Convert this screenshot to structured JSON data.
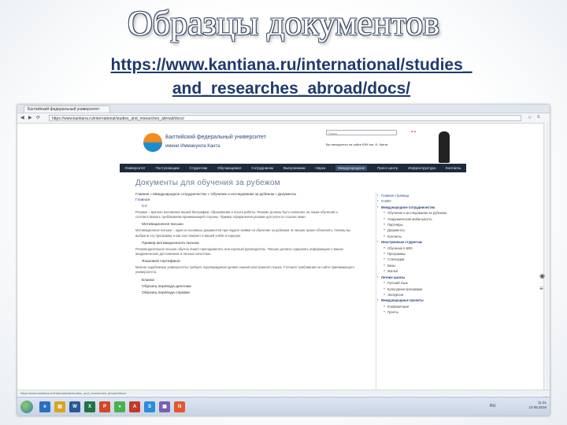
{
  "slide": {
    "title": "Образцы документов",
    "url_line1": "https://www.kantiana.ru/international/studies_",
    "url_line2": "and_researches_abroad/docs/"
  },
  "browser": {
    "tab_label": "Балтийский федеральный университет",
    "address": "https://www.kantiana.ru/international/studies_and_researches_abroad/docs/",
    "status_text": "https://www.kantiana.ru/international/studies_and_researches_abroad/docs/"
  },
  "site": {
    "name": "Балтийский федеральный университет",
    "sub": "имени Иммануила Канта",
    "search_placeholder": "Поиск",
    "flags": "▪ ▪",
    "note": "Вы находитесь на сайте БФУ им. И. Канта"
  },
  "menu": [
    {
      "label": "Университет",
      "active": false
    },
    {
      "label": "Поступающим",
      "active": false
    },
    {
      "label": "Студентам",
      "active": false
    },
    {
      "label": "Обучающимся",
      "active": false
    },
    {
      "label": "Сотрудникам",
      "active": false
    },
    {
      "label": "Выпускникам",
      "active": false
    },
    {
      "label": "Наука",
      "active": false
    },
    {
      "label": "Международное",
      "active": true
    },
    {
      "label": "Пресс-центр",
      "active": false
    },
    {
      "label": "Инфраструктура",
      "active": false
    },
    {
      "label": "Контакты",
      "active": false
    }
  ],
  "content": {
    "heading": "Документы для обучения за рубежом",
    "breadcrumb": "Главная » Международное сотрудничество » Обучение и исследования за рубежом » Документы",
    "intro_label": "Главная",
    "sec_cv": "CV",
    "para1": "Резюме – краткое изложение вашей биографии, образования и опыта работы. Резюме должно быть написано на языке обучения и соответствовать требованиям принимающей стороны. Пример оформления резюме доступен по ссылке ниже.",
    "sec_letter": "Мотивационное письмо",
    "para2": "Мотивационное письмо – один из основных документов при подаче заявки на обучение за рубежом. В письме нужно объяснить, почему вы выбрали эту программу и как она поможет в вашей учёбе и карьере.",
    "link1": "Пример мотивационного письма",
    "para3": "Рекомендательное письмо обычно пишет преподаватель или научный руководитель. Письмо должно содержать информацию о ваших академических достижениях и личных качествах.",
    "sec_lang": "Языковой сертификат",
    "para4": "Многие зарубежные университеты требуют подтверждения уровня знания иностранного языка. Уточните требования на сайте принимающего университета.",
    "sec_forms": "Бланки",
    "link2": "Образец перевода диплома",
    "link3": "Образец перевода справки"
  },
  "sidebar": [
    {
      "label": "Главная страница",
      "level": 0,
      "bold": false
    },
    {
      "label": "О БФУ",
      "level": 0,
      "bold": false
    },
    {
      "label": "Международное сотрудничество",
      "level": 0,
      "bold": true
    },
    {
      "label": "Обучение и исследования за рубежом",
      "level": 1,
      "bold": false
    },
    {
      "label": "Академическая мобильность",
      "level": 1,
      "bold": false
    },
    {
      "label": "Партнёры",
      "level": 1,
      "bold": false
    },
    {
      "label": "Документы",
      "level": 1,
      "bold": false
    },
    {
      "label": "Контакты",
      "level": 1,
      "bold": false
    },
    {
      "label": "Иностранным студентам",
      "level": 0,
      "bold": true
    },
    {
      "label": "Обучение в БФУ",
      "level": 1,
      "bold": false
    },
    {
      "label": "Программы",
      "level": 1,
      "bold": false
    },
    {
      "label": "Стипендии",
      "level": 1,
      "bold": false
    },
    {
      "label": "Визы",
      "level": 1,
      "bold": false
    },
    {
      "label": "Жильё",
      "level": 1,
      "bold": false
    },
    {
      "label": "Летние школы",
      "level": 0,
      "bold": true
    },
    {
      "label": "Русский язык",
      "level": 1,
      "bold": false
    },
    {
      "label": "Культурная программа",
      "level": 1,
      "bold": false
    },
    {
      "label": "Экскурсии",
      "level": 1,
      "bold": false
    },
    {
      "label": "Международные проекты",
      "level": 0,
      "bold": true
    },
    {
      "label": "Конференции",
      "level": 1,
      "bold": false
    },
    {
      "label": "Гранты",
      "level": 1,
      "bold": false
    }
  ],
  "tray": {
    "lang": "RU",
    "time": "11:31",
    "date": "13.05.2016"
  },
  "taskbar_icons": [
    {
      "label": "e",
      "color": "#2a6fc4"
    },
    {
      "label": "▤",
      "color": "#d8a420"
    },
    {
      "label": "W",
      "color": "#2b579a"
    },
    {
      "label": "X",
      "color": "#217346"
    },
    {
      "label": "P",
      "color": "#d24726"
    },
    {
      "label": "●",
      "color": "#4caf50"
    },
    {
      "label": "A",
      "color": "#c0392b"
    },
    {
      "label": "S",
      "color": "#2d8cdb"
    },
    {
      "label": "▦",
      "color": "#7a5fb3"
    },
    {
      "label": "N",
      "color": "#e4572e"
    }
  ]
}
